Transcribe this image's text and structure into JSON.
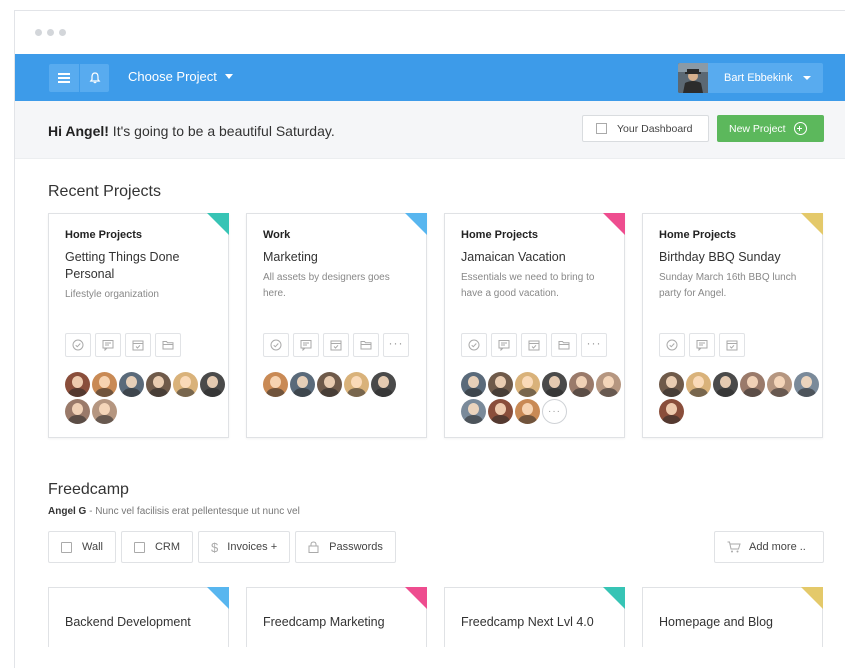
{
  "header": {
    "project_select": "Choose Project",
    "user_name": "Bart Ebbekink"
  },
  "greeting": {
    "name": "Hi Angel!",
    "message": " It's going to be a beautiful Saturday."
  },
  "buttons": {
    "dashboard": "Your Dashboard",
    "new_project": "New Project"
  },
  "recent": {
    "title": "Recent Projects",
    "cards": [
      {
        "category": "Home Projects",
        "title": "Getting Things Done Personal",
        "desc": "Lifestyle organization",
        "color": "#37c4b5",
        "icons": 4,
        "more_icon": false,
        "avatars": 8,
        "more_avatars": false
      },
      {
        "category": "Work",
        "title": "Marketing",
        "desc": "All assets by designers goes here.",
        "color": "#58b6ef",
        "icons": 4,
        "more_icon": true,
        "avatars": 5,
        "more_avatars": false
      },
      {
        "category": "Home Projects",
        "title": "Jamaican Vacation",
        "desc": "Essentials we need to bring to have a good vacation.",
        "color": "#ee4d8f",
        "icons": 4,
        "more_icon": true,
        "avatars": 9,
        "more_avatars": true
      },
      {
        "category": "Home Projects",
        "title": "Birthday BBQ Sunday",
        "desc": "Sunday March 16th BBQ lunch party for Angel.",
        "color": "#e4c96a",
        "icons": 3,
        "more_icon": false,
        "avatars": 7,
        "more_avatars": false
      }
    ]
  },
  "freedcamp": {
    "title": "Freedcamp",
    "owner": "Angel G",
    "description": " - Nunc vel facilisis erat pellentesque ut nunc vel",
    "tools": [
      "Wall",
      "CRM",
      "Invoices +",
      "Passwords"
    ],
    "add_more": "Add more ..",
    "cards": [
      {
        "title": "Backend Development",
        "color": "#58b6ef"
      },
      {
        "title": "Freedcamp Marketing",
        "color": "#ee4d8f"
      },
      {
        "title": "Freedcamp Next Lvl 4.0",
        "color": "#37c4b5"
      },
      {
        "title": "Homepage and Blog",
        "color": "#e4c96a"
      }
    ]
  },
  "avatar_palette": [
    "#8a4e3b",
    "#c98a55",
    "#5a6a7a",
    "#6f5a4a",
    "#d9b27a",
    "#4a4a4a",
    "#9a7a6a",
    "#b59680",
    "#7a8a9a"
  ]
}
